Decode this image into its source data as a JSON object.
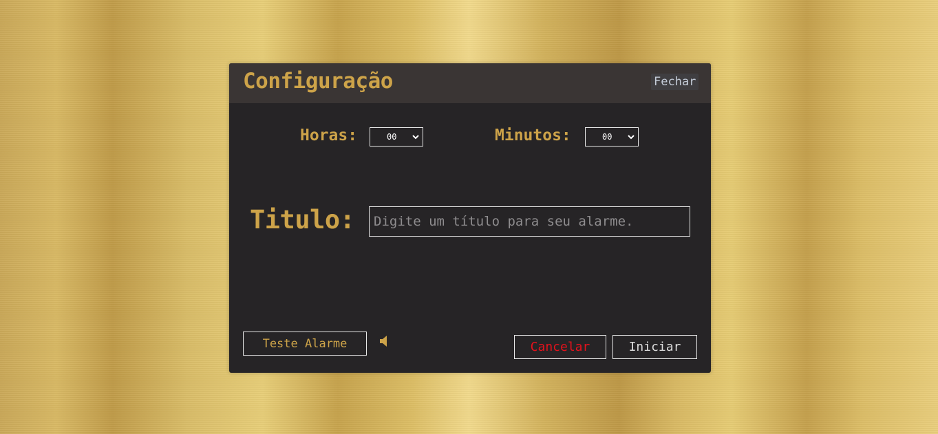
{
  "modal": {
    "title": "Configuração",
    "close_label": "Fechar"
  },
  "time": {
    "hours_label": "Horas:",
    "hours_value": "00",
    "minutes_label": "Minutos:",
    "minutes_value": "00"
  },
  "title_field": {
    "label": "Titulo:",
    "placeholder": "Digite um título para seu alarme.",
    "value": ""
  },
  "actions": {
    "test_label": "Teste Alarme",
    "speaker_icon": "speaker-icon",
    "cancel_label": "Cancelar",
    "start_label": "Iniciar"
  },
  "colors": {
    "accent_gold": "#cda349",
    "modal_bg": "#262426",
    "header_bg": "#3a3534",
    "cancel_red": "#e5121c",
    "border": "#e8e8e8"
  }
}
